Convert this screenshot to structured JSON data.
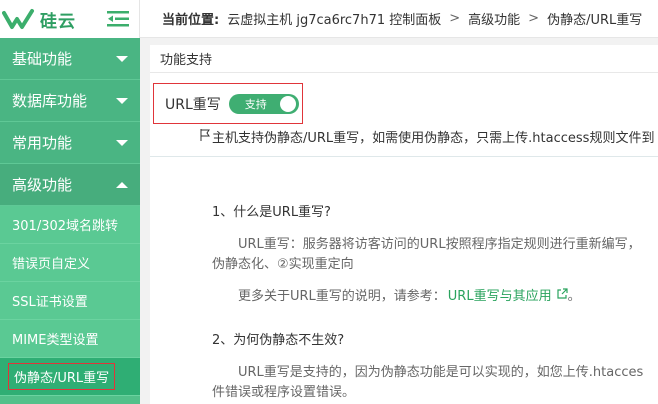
{
  "brand": {
    "name": "硅云",
    "accent": "#52c08a"
  },
  "sidebar": {
    "menus": [
      {
        "label": "基础功能",
        "open": false
      },
      {
        "label": "数据库功能",
        "open": false
      },
      {
        "label": "常用功能",
        "open": false
      },
      {
        "label": "高级功能",
        "open": true
      }
    ],
    "submenu": [
      {
        "label": "301/302域名跳转"
      },
      {
        "label": "错误页自定义"
      },
      {
        "label": "SSL证书设置"
      },
      {
        "label": "MIME类型设置"
      },
      {
        "label": "伪静态/URL重写",
        "active": true
      }
    ]
  },
  "breadcrumb": {
    "label": "当前位置:",
    "items": [
      "云虚拟主机 jg7ca6rc7h71 控制面板",
      "高级功能",
      "伪静态/URL重写"
    ],
    "separator": ">"
  },
  "panel": {
    "title": "功能支持",
    "feature_label": "URL重写",
    "toggle_text": "支持",
    "support_note": "主机支持伪静态/URL重写，如需使用伪静态，只需上传.htaccess规则文件到"
  },
  "faq": {
    "q1_title": "1、什么是URL重写?",
    "q1_line1": "URL重写：服务器将访客访问的URL按照程序指定规则进行重新编写，",
    "q1_line2": "伪静态化、②实现重定向",
    "more_prefix": "更多关于URL重写的说明，请参考：",
    "more_link": "URL重写与其应用",
    "more_suffix": "。",
    "q2_title": "2、为何伪静态不生效?",
    "q2_line1": "URL重写是支持的，因为伪静态功能是可以实现的，如您上传.htacces",
    "q2_line2": "件错误或程序设置错误。"
  }
}
